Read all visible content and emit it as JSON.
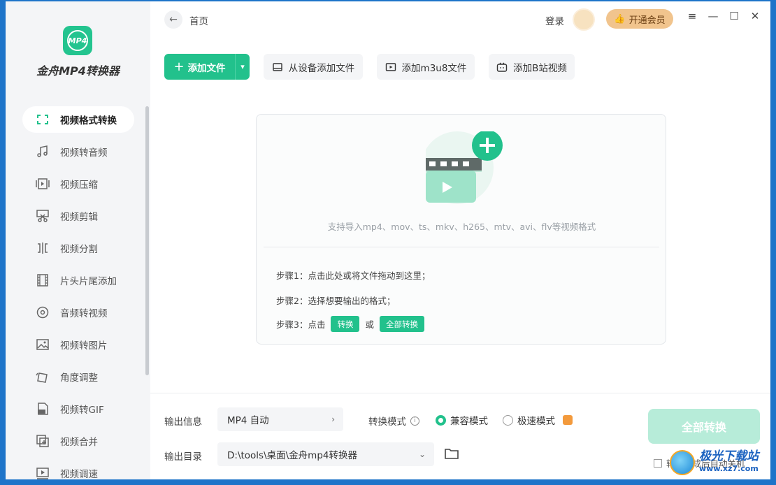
{
  "app": {
    "name": "金舟MP4转换器",
    "logo_text": "MP4"
  },
  "topbar": {
    "breadcrumb": "首页",
    "login": "登录",
    "vip": "开通会员",
    "controls": [
      "menu-icon",
      "minimize-icon",
      "maximize-icon",
      "close-icon"
    ]
  },
  "sidebar": {
    "items": [
      {
        "label": "视频格式转换",
        "icon": "format-convert-icon",
        "active": true
      },
      {
        "label": "视频转音频",
        "icon": "music-note-icon"
      },
      {
        "label": "视频压缩",
        "icon": "compress-icon"
      },
      {
        "label": "视频剪辑",
        "icon": "scissors-icon"
      },
      {
        "label": "视频分割",
        "icon": "split-icon"
      },
      {
        "label": "片头片尾添加",
        "icon": "film-strip-icon"
      },
      {
        "label": "音频转视频",
        "icon": "disc-icon"
      },
      {
        "label": "视频转图片",
        "icon": "image-icon"
      },
      {
        "label": "角度调整",
        "icon": "rotate-icon"
      },
      {
        "label": "视频转GIF",
        "icon": "gif-icon"
      },
      {
        "label": "视频合并",
        "icon": "merge-icon"
      },
      {
        "label": "视频调速",
        "icon": "speed-icon"
      }
    ]
  },
  "toolbar": {
    "add_file": "添加文件",
    "add_from_device": "从设备添加文件",
    "add_m3u8": "添加m3u8文件",
    "add_bilibili": "添加B站视频"
  },
  "dropzone": {
    "support_text": "支持导入mp4、mov、ts、mkv、h265、mtv、avi、flv等视频格式",
    "step1": "步骤1：点击此处或将文件拖动到这里；",
    "step2": "步骤2：选择想要输出的格式；",
    "step3_prefix": "步骤3：点击",
    "step3_chip1": "转换",
    "step3_or": "或",
    "step3_chip2": "全部转换"
  },
  "bottom": {
    "output_info_label": "输出信息",
    "output_format": "MP4 自动",
    "convert_mode_label": "转换模式",
    "mode_compatible": "兼容模式",
    "mode_fast": "极速模式",
    "selected_mode": "兼容模式",
    "output_dir_label": "输出目录",
    "output_dir": "D:\\tools\\桌面\\金舟mp4转换器",
    "convert_all": "全部转换",
    "auto_shutdown": "转换完成后自动关机"
  },
  "watermark": {
    "main": "极光下载站",
    "sub": "www.xz7.com"
  },
  "colors": {
    "accent": "#22c18c",
    "vip": "#f1c48d",
    "desktop": "#1e74c9"
  }
}
